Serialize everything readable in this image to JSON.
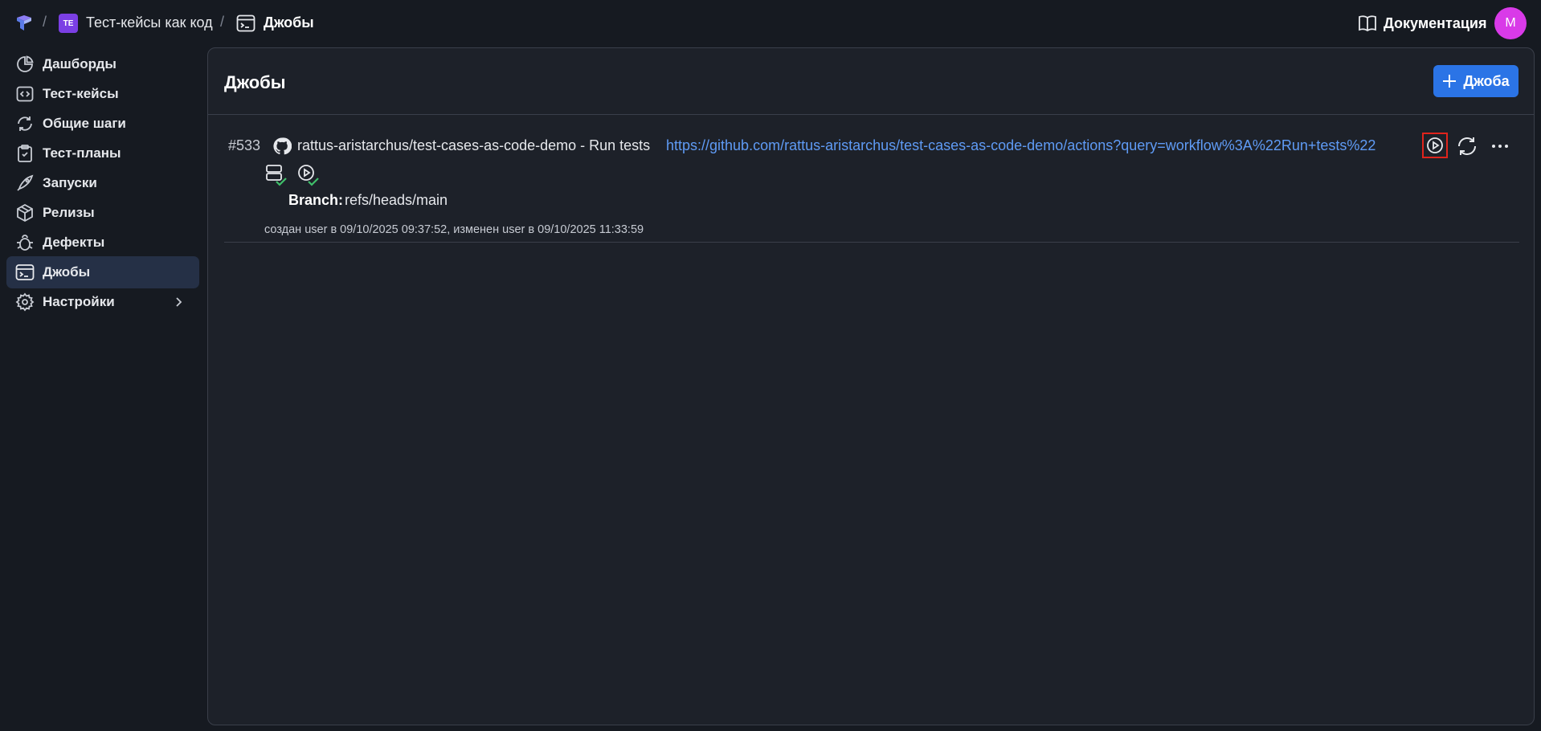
{
  "breadcrumb": {
    "project_badge": "TE",
    "project_name": "Тест-кейсы как код",
    "current": "Джобы",
    "separator": "/"
  },
  "header": {
    "docs_label": "Документация",
    "avatar_initial": "M",
    "avatar_color": "#d93ae8"
  },
  "sidebar": {
    "items": [
      {
        "label": "Дашборды",
        "icon": "pie-chart-icon"
      },
      {
        "label": "Тест-кейсы",
        "icon": "code-square-icon"
      },
      {
        "label": "Общие шаги",
        "icon": "refresh-cycle-icon"
      },
      {
        "label": "Тест-планы",
        "icon": "clipboard-icon"
      },
      {
        "label": "Запуски",
        "icon": "rocket-icon"
      },
      {
        "label": "Релизы",
        "icon": "package-icon"
      },
      {
        "label": "Дефекты",
        "icon": "bug-icon"
      },
      {
        "label": "Джобы",
        "icon": "terminal-icon",
        "active": true
      },
      {
        "label": "Настройки",
        "icon": "gear-icon",
        "has_submenu": true
      }
    ]
  },
  "main": {
    "title": "Джобы",
    "add_button_label": "Джоба",
    "accent_color": "#2b74e6",
    "jobs": [
      {
        "id": "#533",
        "name": "rattus-aristarchus/test-cases-as-code-demo - Run tests",
        "url": "https://github.com/rattus-aristarchus/test-cases-as-code-demo/actions?query=workflow%3A%22Run+tests%22",
        "branch_label": "Branch:",
        "branch": "refs/heads/main",
        "meta": "создан user в 09/10/2025 09:37:52, изменен user в 09/10/2025 11:33:59"
      }
    ]
  }
}
